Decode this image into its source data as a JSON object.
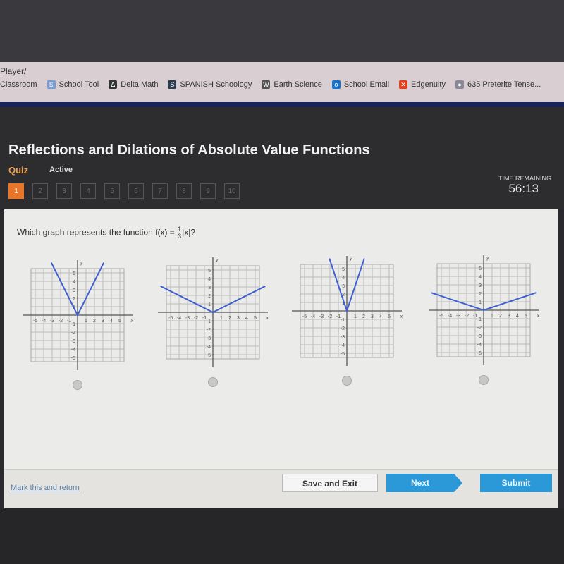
{
  "browser": {
    "url_fragment": "Player/",
    "bookmarks": [
      {
        "label": "Classroom",
        "icon": "none"
      },
      {
        "label": "School Tool",
        "icon": "schooltool-icon"
      },
      {
        "label": "Delta Math",
        "icon": "deltamath-icon"
      },
      {
        "label": "SPANISH Schoology",
        "icon": "schoology-icon"
      },
      {
        "label": "Earth Science",
        "icon": "w-icon"
      },
      {
        "label": "School Email",
        "icon": "outlook-icon"
      },
      {
        "label": "Edgenuity",
        "icon": "edgenuity-icon"
      },
      {
        "label": "635 Preterite Tense...",
        "icon": "globe-icon"
      }
    ]
  },
  "header": {
    "title": "Reflections and Dilations of Absolute Value Functions",
    "type": "Quiz",
    "status": "Active",
    "questions": [
      "1",
      "2",
      "3",
      "4",
      "5",
      "6",
      "7",
      "8",
      "9",
      "10"
    ],
    "current_question": "1",
    "time_label": "TIME REMAINING",
    "time_value": "56:13"
  },
  "question": {
    "text": "Which graph represents the function f(x) = ",
    "fraction_num": "1",
    "fraction_den": "3",
    "text_end": "|x|?"
  },
  "options": [
    {
      "function_slope": 2,
      "selected": false
    },
    {
      "function_slope": 0.5,
      "selected": false
    },
    {
      "function_slope": 3,
      "selected": false
    },
    {
      "function_slope": 0.3333,
      "selected": false
    }
  ],
  "graph_axis": {
    "x_label": "x",
    "y_label": "y",
    "ticks": [
      -5,
      -4,
      -3,
      -2,
      -1,
      1,
      2,
      3,
      4,
      5
    ],
    "line_color": "#3f5fd0"
  },
  "footer": {
    "mark_link": "Mark this and return",
    "save_label": "Save and Exit",
    "next_label": "Next",
    "submit_label": "Submit"
  },
  "colors": {
    "accent": "#e8762a",
    "button_blue": "#2b98d8"
  }
}
